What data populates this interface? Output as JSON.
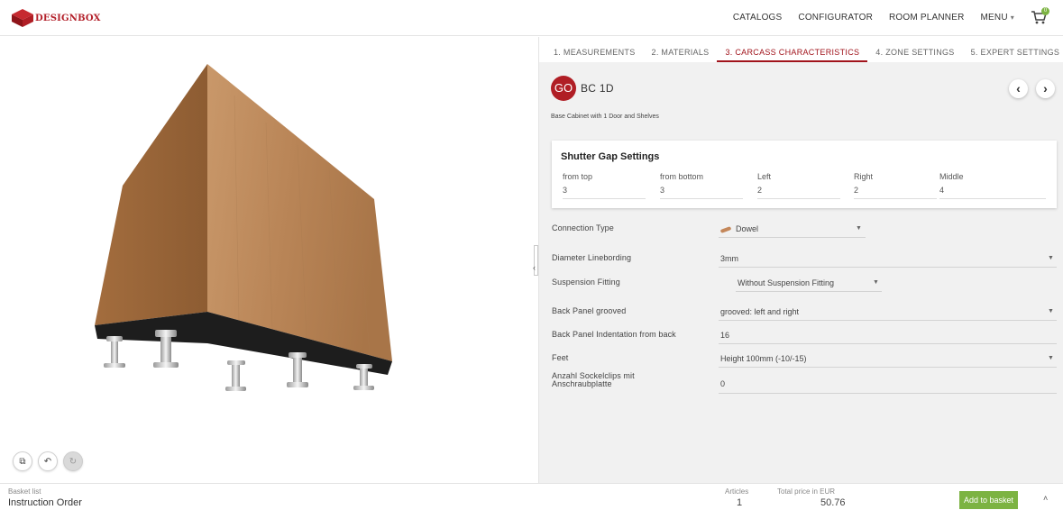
{
  "brand": {
    "name": "DESIGNBOX",
    "accent": "#b01e25"
  },
  "nav": {
    "items": [
      "CATALOGS",
      "CONFIGURATOR",
      "ROOM PLANNER",
      "MENU"
    ],
    "cart_count": "0"
  },
  "toolbar": {
    "icons": [
      "copy-icon",
      "undo-icon",
      "redo-icon"
    ]
  },
  "tabs": [
    {
      "label": "1. MEASUREMENTS",
      "active": false
    },
    {
      "label": "2. MATERIALS",
      "active": false
    },
    {
      "label": "3. CARCASS CHARACTERISTICS",
      "active": true
    },
    {
      "label": "4. ZONE SETTINGS",
      "active": false
    },
    {
      "label": "5. EXPERT SETTINGS",
      "active": false
    }
  ],
  "product": {
    "badge": "GO",
    "code": "BC 1D",
    "description": "Base Cabinet with 1 Door and Shelves"
  },
  "shutter_gap": {
    "title": "Shutter Gap Settings",
    "fields": [
      {
        "label": "from top",
        "value": "3"
      },
      {
        "label": "from bottom",
        "value": "3"
      },
      {
        "label": "Left",
        "value": "2"
      },
      {
        "label": "Right",
        "value": "2"
      },
      {
        "label": "Middle",
        "value": "4"
      }
    ]
  },
  "form": {
    "connection_type": {
      "label": "Connection Type",
      "value": "Dowel"
    },
    "diameter": {
      "label": "Diameter Linebording",
      "value": "3mm"
    },
    "suspension": {
      "label": "Suspension Fitting",
      "value": "Without Suspension Fitting"
    },
    "back_panel": {
      "label": "Back Panel grooved",
      "value": "grooved: left and right"
    },
    "back_indent": {
      "label": "Back Panel Indentation from back",
      "value": "16"
    },
    "feet": {
      "label": "Feet",
      "value": "Height 100mm (-10/-15)"
    },
    "sockelclips": {
      "label": "Anzahl Sockelclips mit Anschraubplatte",
      "value": "0"
    }
  },
  "footer": {
    "basket_label": "Basket list",
    "basket_name": "Instruction Order",
    "articles_label": "Articles",
    "articles_value": "1",
    "price_label": "Total price in EUR",
    "price_value": "50.76",
    "add_button": "Add to basket"
  },
  "colors": {
    "active_tab": "#a1141c",
    "button_green": "#7cb342",
    "panel_bg": "#f1f1f1"
  }
}
